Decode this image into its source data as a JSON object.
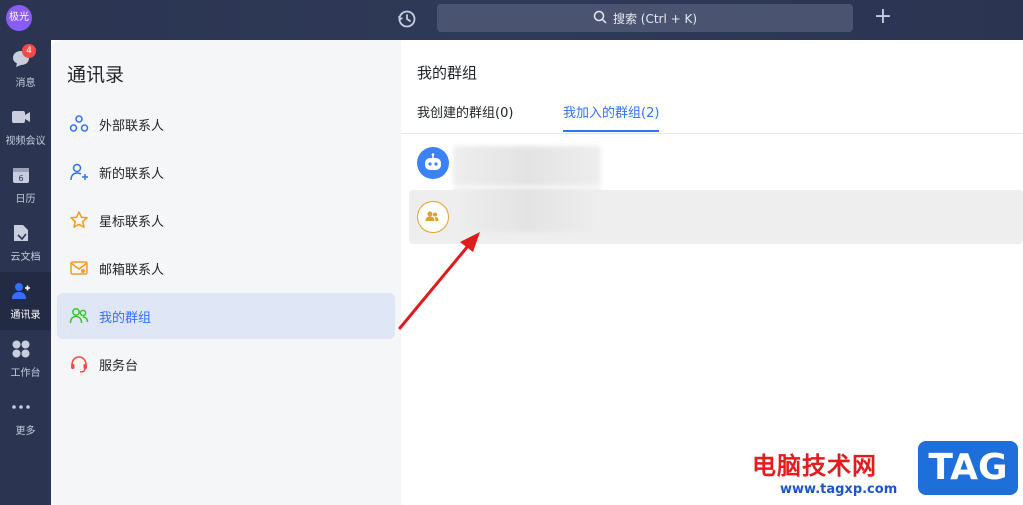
{
  "topbar": {
    "avatar_text": "极光",
    "search_label": "搜索 (Ctrl + K)",
    "plus_label": "+"
  },
  "rail": {
    "items": [
      {
        "label": "消息",
        "icon": "chat-icon",
        "badge": "4"
      },
      {
        "label": "视频会议",
        "icon": "video-icon"
      },
      {
        "label": "日历",
        "icon": "calendar-icon",
        "day": "6"
      },
      {
        "label": "云文档",
        "icon": "doc-icon"
      },
      {
        "label": "通讯录",
        "icon": "contacts-icon",
        "active": true
      },
      {
        "label": "工作台",
        "icon": "apps-icon"
      },
      {
        "label": "更多",
        "icon": "more-icon"
      }
    ]
  },
  "contacts": {
    "title": "通讯录",
    "items": [
      {
        "label": "外部联系人",
        "icon": "external-contacts-icon"
      },
      {
        "label": "新的联系人",
        "icon": "add-contact-icon"
      },
      {
        "label": "星标联系人",
        "icon": "star-icon"
      },
      {
        "label": "邮箱联系人",
        "icon": "mail-contact-icon"
      },
      {
        "label": "我的群组",
        "icon": "group-icon",
        "active": true
      },
      {
        "label": "服务台",
        "icon": "headset-icon"
      }
    ]
  },
  "main": {
    "title": "我的群组",
    "tabs": [
      {
        "label": "我创建的群组(0)"
      },
      {
        "label": "我加入的群组(2)",
        "active": true
      }
    ]
  },
  "watermark": {
    "site_name": "电脑技术网",
    "url": "www.tagxp.com",
    "tag": "TAG"
  },
  "colors": {
    "accent": "#3370ff",
    "sidebar": "#2b3552",
    "badge": "#f54a45",
    "arrow": "#e01b1b"
  }
}
